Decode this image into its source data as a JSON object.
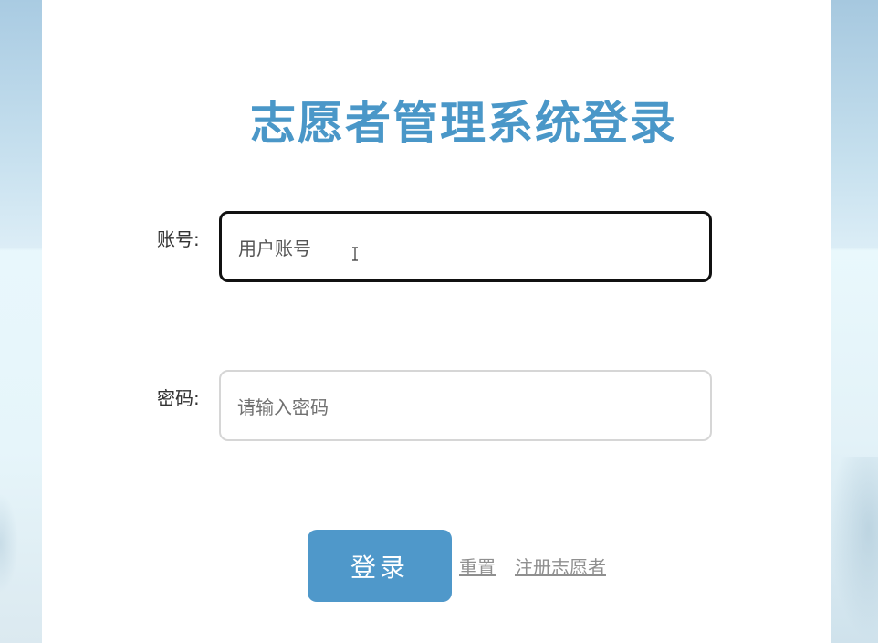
{
  "page": {
    "title": "志愿者管理系统登录"
  },
  "form": {
    "account": {
      "label": "账号:",
      "placeholder": "用户账号"
    },
    "password": {
      "label": "密码:",
      "placeholder": "请输入密码"
    }
  },
  "actions": {
    "login_label": "登录",
    "reset_label": "重置",
    "register_label": "注册志愿者"
  },
  "colors": {
    "accent": "#4f98ca",
    "title": "#4a97c8",
    "link": "#8f8f8f"
  },
  "icons": {
    "text_cursor": "i-beam-cursor-icon"
  }
}
